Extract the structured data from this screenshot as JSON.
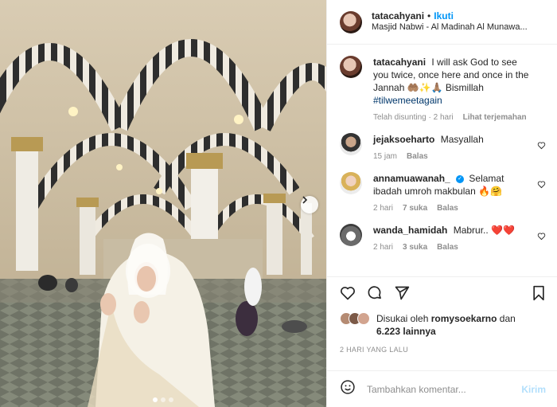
{
  "header": {
    "username": "tatacahyani",
    "separator": "•",
    "follow_label": "Ikuti",
    "location": "Masjid Nabwi - Al Madinah Al Munawa..."
  },
  "caption": {
    "username": "tatacahyani",
    "text": "I will ask God to see you twice, once here and once in the Jannah 🤲🏽✨🙏🏽 Bismillah",
    "hashtag": "#tilwemeetagain",
    "edited": "Telah disunting · 2 hari",
    "translate": "Lihat terjemahan"
  },
  "comments": [
    {
      "username": "jejaksoeharto",
      "text": "Masyallah",
      "time": "15 jam",
      "likes": "",
      "reply": "Balas"
    },
    {
      "username": "annamuawanah_",
      "text": "Selamat ibadah umroh makbulan 🔥🤗",
      "time": "2 hari",
      "likes": "7 suka",
      "reply": "Balas"
    },
    {
      "username": "wanda_hamidah",
      "text": "Mabrur.. ❤️❤️",
      "time": "2 hari",
      "likes": "3 suka",
      "reply": "Balas"
    }
  ],
  "likes_text": {
    "prefix": "Disukai oleh",
    "user": "romysoekarno",
    "joiner": "dan",
    "others": "6.223 lainnya"
  },
  "post_date": "2 HARI YANG LALU",
  "composer": {
    "placeholder": "Tambahkan komentar...",
    "post_label": "Kirim"
  },
  "icons": {
    "like": "heart-icon",
    "comment": "comment-icon",
    "share": "share-icon",
    "save": "bookmark-icon",
    "emoji": "smiley-icon",
    "next": "chevron-right-icon"
  },
  "colors": {
    "accent": "#0095f6",
    "hashtag": "#00376b",
    "muted": "#8e8e8e",
    "heart_red": "#ed4956"
  }
}
